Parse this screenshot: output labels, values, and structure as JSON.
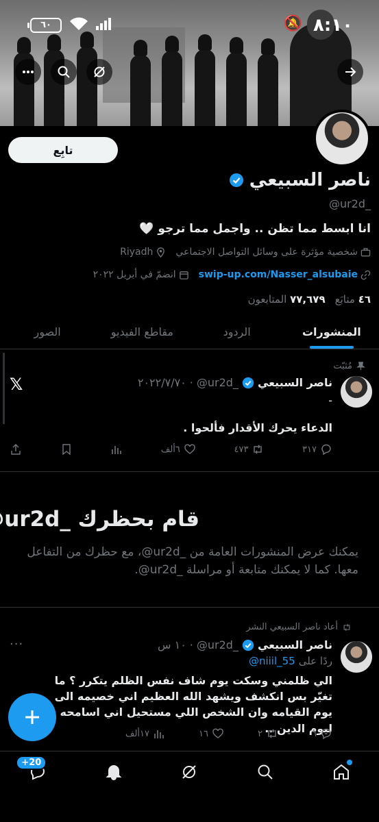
{
  "status_bar": {
    "time": "٨:١٠",
    "battery": "٦٠"
  },
  "profile": {
    "follow_label": "تابِع",
    "display_name": "ناصر السبيعي",
    "handle": "@ur2d_",
    "bio": "انا ابسط مما تظن .. واجمل مما ترجو 🤍",
    "category": "شخصية مؤثرة على وسائل التواصل الاجتماعي",
    "location": "Riyadh",
    "link": "swip-up.com/Nasser_alsubaie",
    "joined": "انضمّ في أبريل ٢٠٢٢",
    "following_count": "٤٦",
    "following_label": "متابَع",
    "followers_count": "٧٧,٦٧٩",
    "followers_label": "المتابعون"
  },
  "tabs": [
    {
      "label": "المنشورات"
    },
    {
      "label": "الردود"
    },
    {
      "label": "مقاطع الفيديو"
    },
    {
      "label": "الصور"
    }
  ],
  "pinned_tweet": {
    "pinned_label": "مُثبّت",
    "name": "ناصر السبيعي",
    "handle": "@ur2d_",
    "date": "٢٠٢٢/٧/٧٠",
    "dash": "-",
    "text": "الدعاء يحرك الأقدار فألحوا .",
    "replies": "٣١٧",
    "reposts": "٤٧٣",
    "likes": "٦ألف"
  },
  "blocked": {
    "title": "قام بحظرك ‎@ur2d_‎",
    "text": "يمكنك عرض المنشورات العامة من ‎@ur2d_‎، مع حظرك من التفاعل معها. كما لا يمكنك متابعة أو مراسلة ‎@ur2d_‎."
  },
  "repost_tweet": {
    "repost_label": "أعاد ناصر السبيعي النشر",
    "name": "ناصر السبيعي",
    "handle": "@ur2d_",
    "time": "١٠ س",
    "reply_prefix": "ردًا على",
    "reply_to": "@niiil_55",
    "text": "الي ظلمني وسكت يوم شاف نفس الظلم يتكرر ؟ ما تغيّر بس انكشف ويشهد الله العظيم اني خصيمه الى يوم القيامه وان الشخص اللي مستحيل اني اسامحه ليوم الدين ..",
    "replies": "٦",
    "reposts": "٢",
    "likes": "١٦",
    "views": "١٧ألف"
  },
  "bottom_nav": {
    "notifications_badge": "+20"
  },
  "colors": {
    "accent": "#1d9bf0",
    "background": "#000000",
    "muted": "#71767b"
  }
}
